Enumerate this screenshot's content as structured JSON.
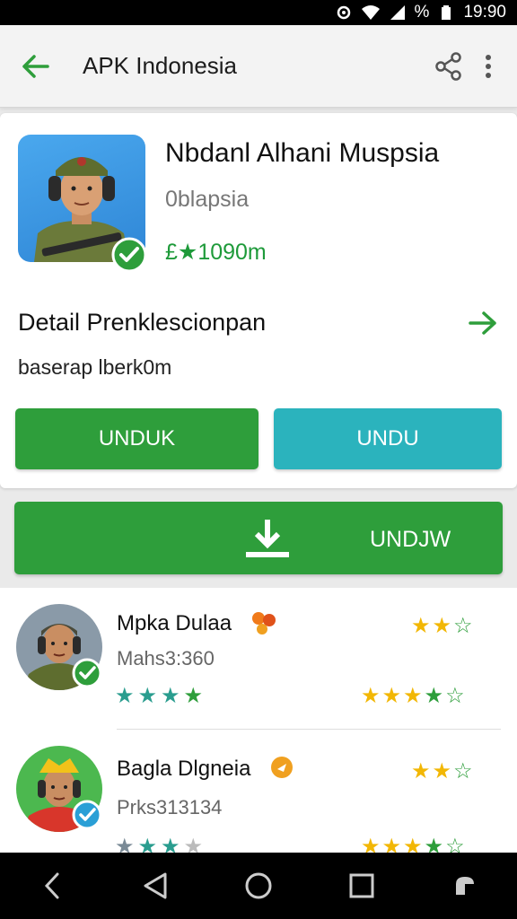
{
  "status_bar": {
    "time": "19:90",
    "battery_text": "%"
  },
  "app_bar": {
    "title": "APK Indonesia"
  },
  "app": {
    "name": "Nbdanl Alhani Muspsia",
    "developer": "0blapsia",
    "meta": "£★1090m"
  },
  "detail": {
    "title": "Detail Prenklescionpan",
    "subtitle": "baserap lberk0m"
  },
  "buttons": {
    "primary_label": "UNDUK",
    "secondary_label": "UNDU",
    "download_label": "UNDJW"
  },
  "reviews": [
    {
      "name": "Mpka Dulaa",
      "meta": "Mahs3:360",
      "badge_color": "#f07a1a"
    },
    {
      "name": "Bagla Dlgneia",
      "meta": "Prks313134",
      "badge_color": "#f0a020"
    }
  ],
  "colors": {
    "accent_green": "#2e9e3b",
    "accent_teal": "#2bb3bd",
    "star_gold": "#f2b705",
    "star_teal": "#2a9d8f"
  }
}
